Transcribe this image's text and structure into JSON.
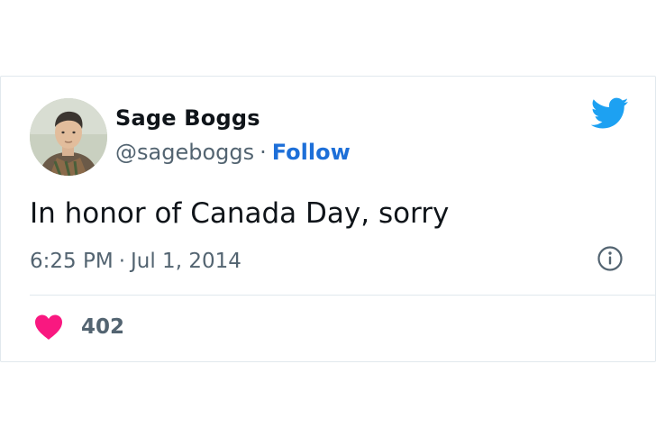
{
  "tweet": {
    "author": {
      "name": "Sage Boggs",
      "handle": "@sageboggs",
      "separator": "·",
      "follow_label": "Follow"
    },
    "text": "In honor of Canada Day, sorry",
    "time": "6:25 PM",
    "date": "Jul 1, 2014",
    "likes": "402"
  },
  "icons": {
    "brand": "twitter-bird-icon",
    "info": "info-icon",
    "like": "heart-icon"
  },
  "colors": {
    "follow_link": "#1d6fd8",
    "twitter_blue": "#1da1f2",
    "heart": "#f91880",
    "secondary_text": "#536471",
    "primary_text": "#0f1419",
    "border": "#e1e8ed"
  }
}
